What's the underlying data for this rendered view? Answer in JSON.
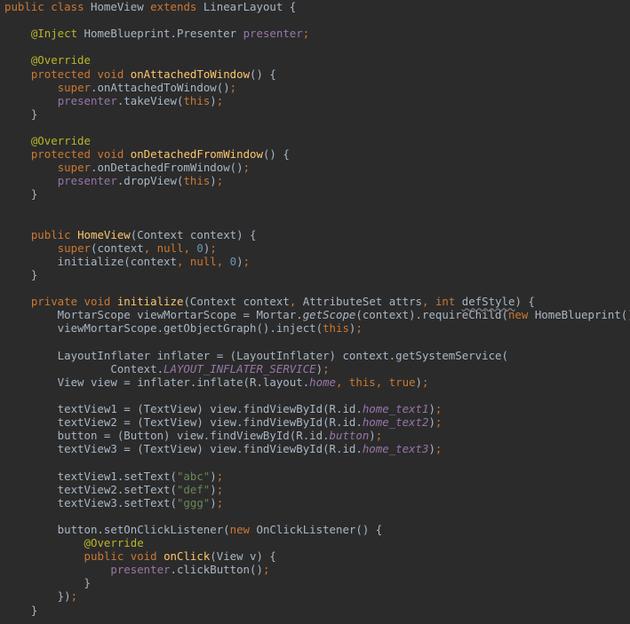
{
  "editor": {
    "lines": [
      [
        {
          "t": "public",
          "c": "kw"
        },
        {
          "t": " "
        },
        {
          "t": "class",
          "c": "kw"
        },
        {
          "t": " HomeView "
        },
        {
          "t": "extends",
          "c": "kw"
        },
        {
          "t": " LinearLayout {"
        }
      ],
      [],
      [
        {
          "t": "    "
        },
        {
          "t": "@Inject",
          "c": "ann"
        },
        {
          "t": " HomeBlueprint.Presenter "
        },
        {
          "t": "presenter",
          "c": "field"
        },
        {
          "t": ";",
          "c": "kw"
        }
      ],
      [],
      [
        {
          "t": "    "
        },
        {
          "t": "@Override",
          "c": "ann"
        }
      ],
      [
        {
          "t": "    "
        },
        {
          "t": "protected",
          "c": "kw"
        },
        {
          "t": " "
        },
        {
          "t": "void",
          "c": "kw"
        },
        {
          "t": " "
        },
        {
          "t": "onAttachedToWindow",
          "c": "fn"
        },
        {
          "t": "() {"
        }
      ],
      [
        {
          "t": "        "
        },
        {
          "t": "super",
          "c": "kw"
        },
        {
          "t": ".onAttachedToWindow()"
        },
        {
          "t": ";",
          "c": "kw"
        }
      ],
      [
        {
          "t": "        "
        },
        {
          "t": "presenter",
          "c": "field"
        },
        {
          "t": ".takeView("
        },
        {
          "t": "this",
          "c": "kw"
        },
        {
          "t": ")"
        },
        {
          "t": ";",
          "c": "kw"
        }
      ],
      [
        {
          "t": "    }"
        }
      ],
      [],
      [
        {
          "t": "    "
        },
        {
          "t": "@Override",
          "c": "ann"
        }
      ],
      [
        {
          "t": "    "
        },
        {
          "t": "protected",
          "c": "kw"
        },
        {
          "t": " "
        },
        {
          "t": "void",
          "c": "kw"
        },
        {
          "t": " "
        },
        {
          "t": "onDetachedFromWindow",
          "c": "fn"
        },
        {
          "t": "() {"
        }
      ],
      [
        {
          "t": "        "
        },
        {
          "t": "super",
          "c": "kw"
        },
        {
          "t": ".onDetachedFromWindow()"
        },
        {
          "t": ";",
          "c": "kw"
        }
      ],
      [
        {
          "t": "        "
        },
        {
          "t": "presenter",
          "c": "field"
        },
        {
          "t": ".dropView("
        },
        {
          "t": "this",
          "c": "kw"
        },
        {
          "t": ")"
        },
        {
          "t": ";",
          "c": "kw"
        }
      ],
      [
        {
          "t": "    }"
        }
      ],
      [],
      [],
      [
        {
          "t": "    "
        },
        {
          "t": "public",
          "c": "kw"
        },
        {
          "t": " "
        },
        {
          "t": "HomeView",
          "c": "fn"
        },
        {
          "t": "(Context context) {"
        }
      ],
      [
        {
          "t": "        "
        },
        {
          "t": "super",
          "c": "kw"
        },
        {
          "t": "(context"
        },
        {
          "t": ", ",
          "c": "kw"
        },
        {
          "t": "null",
          "c": "kw"
        },
        {
          "t": ", ",
          "c": "kw"
        },
        {
          "t": "0",
          "c": "num"
        },
        {
          "t": ")"
        },
        {
          "t": ";",
          "c": "kw"
        }
      ],
      [
        {
          "t": "        initialize(context"
        },
        {
          "t": ", ",
          "c": "kw"
        },
        {
          "t": "null",
          "c": "kw"
        },
        {
          "t": ", ",
          "c": "kw"
        },
        {
          "t": "0",
          "c": "num"
        },
        {
          "t": ")"
        },
        {
          "t": ";",
          "c": "kw"
        }
      ],
      [
        {
          "t": "    }"
        }
      ],
      [],
      [
        {
          "t": "    "
        },
        {
          "t": "private",
          "c": "kw"
        },
        {
          "t": " "
        },
        {
          "t": "void",
          "c": "kw"
        },
        {
          "t": " "
        },
        {
          "t": "initialize",
          "c": "fn"
        },
        {
          "t": "(Context context"
        },
        {
          "t": ", ",
          "c": "kw"
        },
        {
          "t": "AttributeSet attrs"
        },
        {
          "t": ", ",
          "c": "kw"
        },
        {
          "t": "int",
          "c": "kw"
        },
        {
          "t": " "
        },
        {
          "t": "defStyle",
          "c": "squig"
        },
        {
          "t": ") {"
        }
      ],
      [
        {
          "t": "        MortarScope viewMortarScope = Mortar."
        },
        {
          "t": "getScope",
          "c": "italic"
        },
        {
          "t": "(context).requireChild("
        },
        {
          "t": "new",
          "c": "kw"
        },
        {
          "t": " HomeBlueprint())"
        },
        {
          "t": ";",
          "c": "kw"
        }
      ],
      [
        {
          "t": "        viewMortarScope.getObjectGraph().inject("
        },
        {
          "t": "this",
          "c": "kw"
        },
        {
          "t": ")"
        },
        {
          "t": ";",
          "c": "kw"
        }
      ],
      [],
      [
        {
          "t": "        LayoutInflater inflater = (LayoutInflater) context.getSystemService("
        }
      ],
      [
        {
          "t": "                Context."
        },
        {
          "t": "LAYOUT_INFLATER_SERVICE",
          "c": "const"
        },
        {
          "t": ")"
        },
        {
          "t": ";",
          "c": "kw"
        }
      ],
      [
        {
          "t": "        View view = inflater.inflate(R.layout."
        },
        {
          "t": "home",
          "c": "const"
        },
        {
          "t": ", ",
          "c": "kw"
        },
        {
          "t": "this",
          "c": "kw"
        },
        {
          "t": ", ",
          "c": "kw"
        },
        {
          "t": "true",
          "c": "kw"
        },
        {
          "t": ")"
        },
        {
          "t": ";",
          "c": "kw"
        }
      ],
      [],
      [
        {
          "t": "        textView1 = (TextView) view.findViewById(R.id."
        },
        {
          "t": "home_text1",
          "c": "const"
        },
        {
          "t": ")"
        },
        {
          "t": ";",
          "c": "kw"
        }
      ],
      [
        {
          "t": "        textView2 = (TextView) view.findViewById(R.id."
        },
        {
          "t": "home_text2",
          "c": "const"
        },
        {
          "t": ")"
        },
        {
          "t": ";",
          "c": "kw"
        }
      ],
      [
        {
          "t": "        button = (Button) view.findViewById(R.id."
        },
        {
          "t": "button",
          "c": "const"
        },
        {
          "t": ")"
        },
        {
          "t": ";",
          "c": "kw"
        }
      ],
      [
        {
          "t": "        textView3 = (TextView) view.findViewById(R.id."
        },
        {
          "t": "home_text3",
          "c": "const"
        },
        {
          "t": ")"
        },
        {
          "t": ";",
          "c": "kw"
        }
      ],
      [],
      [
        {
          "t": "        textView1.setText("
        },
        {
          "t": "\"abc\"",
          "c": "str"
        },
        {
          "t": ")"
        },
        {
          "t": ";",
          "c": "kw"
        }
      ],
      [
        {
          "t": "        textView2.setText("
        },
        {
          "t": "\"def\"",
          "c": "str"
        },
        {
          "t": ")"
        },
        {
          "t": ";",
          "c": "kw"
        }
      ],
      [
        {
          "t": "        textView3.setText("
        },
        {
          "t": "\"ggg\"",
          "c": "str"
        },
        {
          "t": ")"
        },
        {
          "t": ";",
          "c": "kw"
        }
      ],
      [],
      [
        {
          "t": "        button.setOnClickListener("
        },
        {
          "t": "new",
          "c": "kw"
        },
        {
          "t": " OnClickListener() {"
        }
      ],
      [
        {
          "t": "            "
        },
        {
          "t": "@Override",
          "c": "ann"
        }
      ],
      [
        {
          "t": "            "
        },
        {
          "t": "public",
          "c": "kw"
        },
        {
          "t": " "
        },
        {
          "t": "void",
          "c": "kw"
        },
        {
          "t": " "
        },
        {
          "t": "onClick",
          "c": "fn"
        },
        {
          "t": "(View v) {"
        }
      ],
      [
        {
          "t": "                "
        },
        {
          "t": "presenter",
          "c": "field"
        },
        {
          "t": ".clickButton()"
        },
        {
          "t": ";",
          "c": "kw"
        }
      ],
      [
        {
          "t": "            }"
        }
      ],
      [
        {
          "t": "        })"
        },
        {
          "t": ";",
          "c": "kw"
        }
      ],
      [
        {
          "t": "    }"
        }
      ]
    ]
  },
  "colors": {
    "background": "#2b2b2b",
    "default_text": "#a9b7c6",
    "keyword": "#cc7832",
    "annotation": "#bbb529",
    "method_declaration": "#ffc66d",
    "field": "#9876aa",
    "number": "#6897bb",
    "string": "#6a8759"
  }
}
